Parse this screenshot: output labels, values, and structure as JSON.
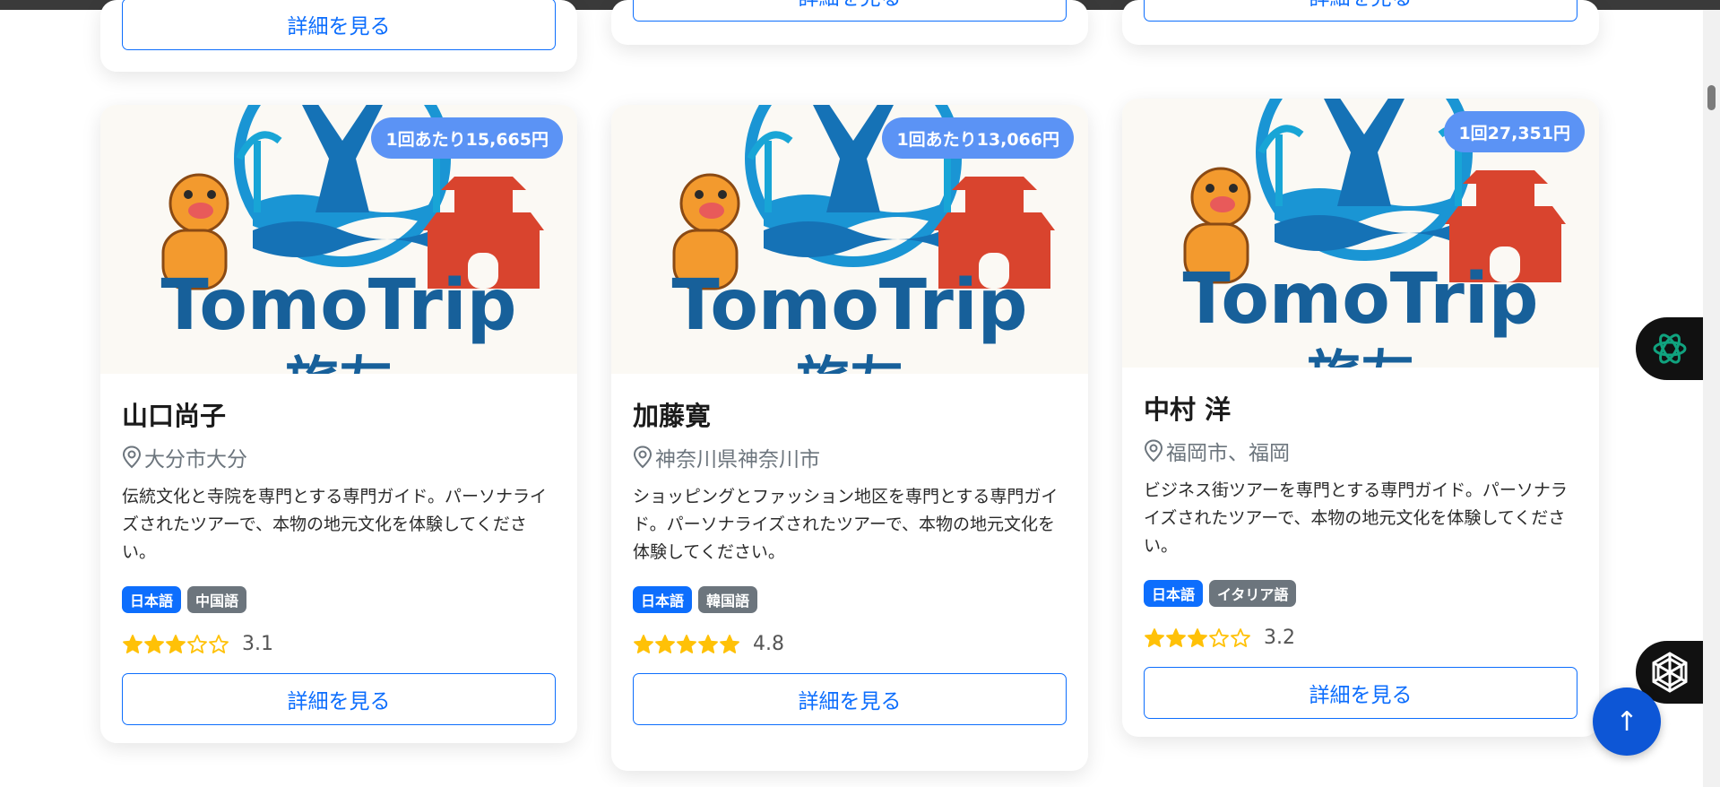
{
  "top_cards": [
    {
      "button_label": "詳細を見る"
    },
    {
      "button_label": "詳細を見る"
    },
    {
      "button_label": "詳細を見る"
    }
  ],
  "cards": [
    {
      "image_brand": "TomoTrip",
      "image_brand_sub": "旅友",
      "price_badge": "1回あたり15,665円",
      "name": "山口尚子",
      "location": "大分市大分",
      "description": "伝統文化と寺院を専門とする専門ガイド。パーソナライズされたツアーで、本物の地元文化を体験してください。",
      "languages": [
        "日本語",
        "中国語"
      ],
      "rating": 3.1,
      "rating_text": "3.1",
      "button_label": "詳細を見る"
    },
    {
      "image_brand": "TomoTrip",
      "image_brand_sub": "旅友",
      "price_badge": "1回あたり13,066円",
      "name": "加藤寛",
      "location": "神奈川県神奈川市",
      "description": "ショッピングとファッション地区を専門とする専門ガイド。パーソナライズされたツアーで、本物の地元文化を体験してください。",
      "languages": [
        "日本語",
        "韓国語"
      ],
      "rating": 4.8,
      "rating_text": "4.8",
      "button_label": "詳細を見る"
    },
    {
      "image_brand": "TomoTrip",
      "image_brand_sub": "旅友",
      "price_badge": "1回27,351円",
      "name": "中村 洋",
      "location": "福岡市、福岡",
      "description": "ビジネス街ツアーを専門とする専門ガイド。パーソナライズされたツアーで、本物の地元文化を体験してください。",
      "languages": [
        "日本語",
        "イタリア語"
      ],
      "rating": 3.2,
      "rating_text": "3.2",
      "button_label": "詳細を見る"
    }
  ],
  "colors": {
    "primary": "#0d6efd",
    "price_badge": "#5b93f5",
    "star": "#ffc107",
    "secondary_badge": "#6c757d"
  },
  "icons": {
    "location": "geo-pin-icon",
    "scroll_top": "arrow-up-icon",
    "chatgpt_widget": "openai-logo-icon",
    "assistant_widget": "hexagon-logo-icon"
  },
  "scroll_top_glyph": "↑"
}
